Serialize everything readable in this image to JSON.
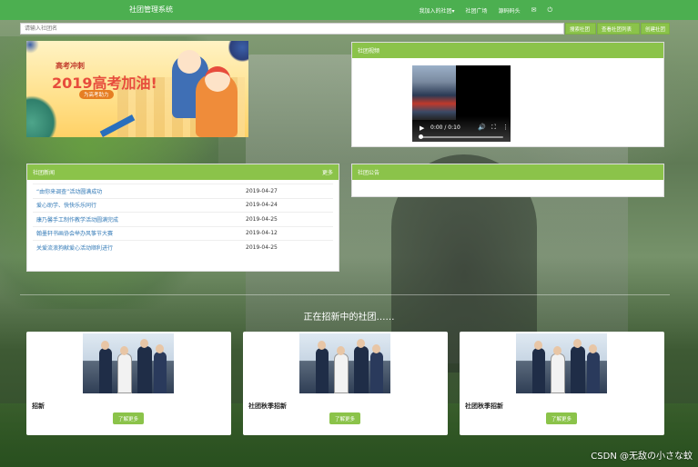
{
  "navbar": {
    "brand": "社团管理系统",
    "links": [
      "我加入的社团▾",
      "社团广场",
      "源码码头"
    ],
    "icons": [
      "mail-icon",
      "power-icon"
    ]
  },
  "search": {
    "placeholder": "请输入社团名",
    "buttons": [
      "搜索社团",
      "查看社团列表",
      "创建社团"
    ]
  },
  "banner": {
    "subtitle": "高考冲刺",
    "title": "2019高考加油!",
    "tag": "为高考助力"
  },
  "video_panel": {
    "title": "社团视频",
    "time": "0:00 / 0:10"
  },
  "news_panel": {
    "title": "社团新闻",
    "more": "更多",
    "items": [
      {
        "title": "“由你来调查”活动圆满成功",
        "date": "2019-04-27"
      },
      {
        "title": "爱心助学、快快乐乐同行",
        "date": "2019-04-24"
      },
      {
        "title": "康乃馨手工制作教学活动圆满完成",
        "date": "2019-04-25"
      },
      {
        "title": "翰墨轩书画协会举办风筝节大赛",
        "date": "2019-04-12"
      },
      {
        "title": "关爱流浪狗献爱心活动顺利进行",
        "date": "2019-04-25"
      }
    ]
  },
  "notice_panel": {
    "title": "社团公告"
  },
  "recruit": {
    "title": "正在招新中的社团……",
    "cards": [
      {
        "name": "招新",
        "button": "了解更多"
      },
      {
        "name": "社团秋季招新",
        "button": "了解更多"
      },
      {
        "name": "社团秋季招新",
        "button": "了解更多"
      }
    ]
  },
  "watermark": "CSDN @无敌の小さな蚊",
  "colors": {
    "navbar": "#4caf50",
    "accent": "#8bc34a",
    "link": "#337ab7"
  }
}
